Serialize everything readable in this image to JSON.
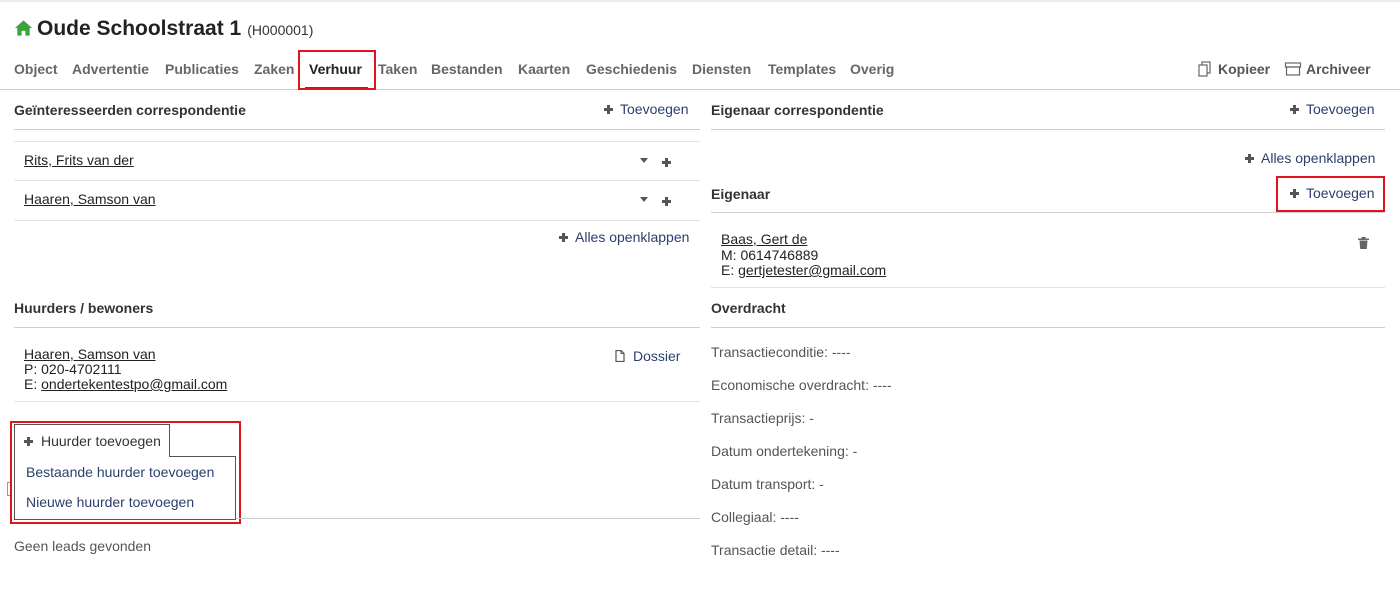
{
  "header": {
    "title": "Oude Schoolstraat 1",
    "code": "(H000001)"
  },
  "tabs": [
    {
      "label": "Object"
    },
    {
      "label": "Advertentie"
    },
    {
      "label": "Publicaties"
    },
    {
      "label": "Zaken"
    },
    {
      "label": "Verhuur",
      "active": true
    },
    {
      "label": "Taken"
    },
    {
      "label": "Bestanden"
    },
    {
      "label": "Kaarten"
    },
    {
      "label": "Geschiedenis"
    },
    {
      "label": "Diensten"
    },
    {
      "label": "Templates"
    },
    {
      "label": "Overig"
    }
  ],
  "actions": {
    "copy": "Kopieer",
    "archive": "Archiveer"
  },
  "interested": {
    "title": "Geïnteresseerden correspondentie",
    "add": "Toevoegen",
    "people": [
      "Rits, Frits van der",
      "Haaren, Samson van"
    ],
    "expand_all": "Alles openklappen"
  },
  "tenants": {
    "title": "Huurders / bewoners",
    "tenant": {
      "name": "Haaren, Samson van",
      "phone": "P: 020-4702111",
      "email_prefix": "E:",
      "email": "ondertekentestpo@gmail.com"
    },
    "dossier": "Dossier",
    "add_button": "Huurder toevoegen",
    "menu": [
      "Bestaande huurder toevoegen",
      "Nieuwe huurder toevoegen"
    ]
  },
  "leads": {
    "empty": "Geen leads gevonden"
  },
  "owner_corr": {
    "title": "Eigenaar correspondentie",
    "add": "Toevoegen",
    "expand_all": "Alles openklappen"
  },
  "owner": {
    "title": "Eigenaar",
    "add": "Toevoegen",
    "name": "Baas, Gert de",
    "mobile": "M: 0614746889",
    "email_prefix": "E:",
    "email": "gertjetester@gmail.com"
  },
  "transfer": {
    "title": "Overdracht",
    "fields": [
      "Transactieconditie: ----",
      "Economische overdracht: ----",
      "Transactieprijs: -",
      "Datum ondertekening: -",
      "Datum transport: -",
      "Collegiaal: ----",
      "Transactie detail: ----"
    ]
  },
  "colors": {
    "accent": "#2e4a8a",
    "link": "#2b3f6b",
    "highlight": "#e0141e",
    "home_icon": "#3aa53a"
  },
  "icons": [
    "home-icon",
    "copy-icon",
    "archive-icon",
    "plus-icon",
    "caret-down-icon",
    "file-icon",
    "trash-icon"
  ]
}
